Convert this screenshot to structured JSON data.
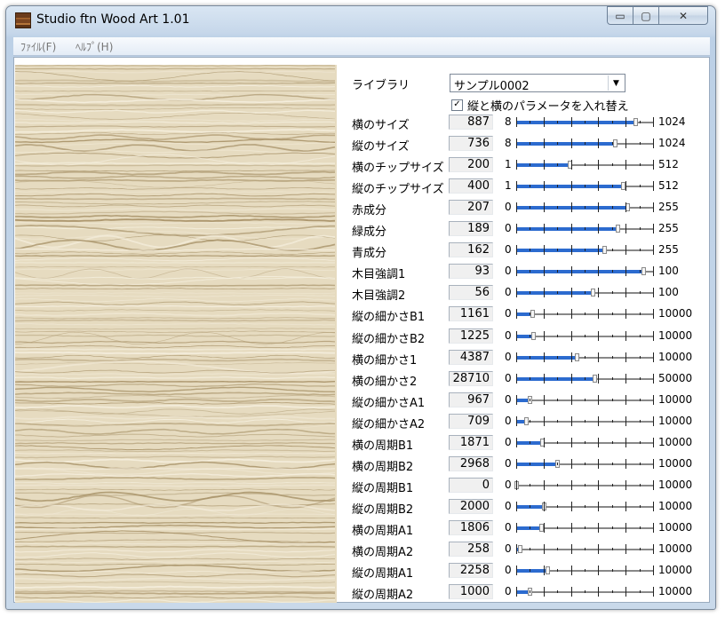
{
  "window": {
    "title": "Studio ftn Wood Art 1.01"
  },
  "titlebar_buttons": {
    "minimize": "▭",
    "maximize": "▢",
    "close": "✕"
  },
  "menu": [
    {
      "label": "ﾌｧｲﾙ(F)"
    },
    {
      "label": "ﾍﾙﾌﾟ(H)"
    }
  ],
  "library": {
    "label": "ライブラリ",
    "selected": "サンプル0002",
    "dropdown_icon": "chevron-down-icon"
  },
  "swap_checkbox": {
    "checked": true,
    "label": "縦と横のパラメータを入れ替え"
  },
  "wood_colors": {
    "base": "#e6dbc0",
    "dark": "#a58f64",
    "light": "#f6f0e0"
  },
  "sliders": [
    {
      "label": "横のサイズ",
      "value": "887",
      "min": "8",
      "max": "1024",
      "fraction": 0.87
    },
    {
      "label": "縦のサイズ",
      "value": "736",
      "min": "8",
      "max": "1024",
      "fraction": 0.72
    },
    {
      "label": "横のチップサイズ",
      "value": "200",
      "min": "1",
      "max": "512",
      "fraction": 0.39
    },
    {
      "label": "縦のチップサイズ",
      "value": "400",
      "min": "1",
      "max": "512",
      "fraction": 0.78
    },
    {
      "label": "赤成分",
      "value": "207",
      "min": "0",
      "max": "255",
      "fraction": 0.81
    },
    {
      "label": "緑成分",
      "value": "189",
      "min": "0",
      "max": "255",
      "fraction": 0.74
    },
    {
      "label": "青成分",
      "value": "162",
      "min": "0",
      "max": "255",
      "fraction": 0.64
    },
    {
      "label": "木目強調1",
      "value": "93",
      "min": "0",
      "max": "100",
      "fraction": 0.93
    },
    {
      "label": "木目強調2",
      "value": "56",
      "min": "0",
      "max": "100",
      "fraction": 0.56
    },
    {
      "label": "縦の細かさB1",
      "value": "1161",
      "min": "0",
      "max": "10000",
      "fraction": 0.116
    },
    {
      "label": "縦の細かさB2",
      "value": "1225",
      "min": "0",
      "max": "10000",
      "fraction": 0.123
    },
    {
      "label": "横の細かさ1",
      "value": "4387",
      "min": "0",
      "max": "10000",
      "fraction": 0.439
    },
    {
      "label": "横の細かさ2",
      "value": "28710",
      "min": "0",
      "max": "50000",
      "fraction": 0.574
    },
    {
      "label": "縦の細かさA1",
      "value": "967",
      "min": "0",
      "max": "10000",
      "fraction": 0.097
    },
    {
      "label": "縦の細かさA2",
      "value": "709",
      "min": "0",
      "max": "10000",
      "fraction": 0.071
    },
    {
      "label": "横の周期B1",
      "value": "1871",
      "min": "0",
      "max": "10000",
      "fraction": 0.187
    },
    {
      "label": "横の周期B2",
      "value": "2968",
      "min": "0",
      "max": "10000",
      "fraction": 0.297
    },
    {
      "label": "縦の周期B1",
      "value": "0",
      "min": "0",
      "max": "10000",
      "fraction": 0.0
    },
    {
      "label": "縦の周期B2",
      "value": "2000",
      "min": "0",
      "max": "10000",
      "fraction": 0.2
    },
    {
      "label": "横の周期A1",
      "value": "1806",
      "min": "0",
      "max": "10000",
      "fraction": 0.181
    },
    {
      "label": "横の周期A2",
      "value": "258",
      "min": "0",
      "max": "10000",
      "fraction": 0.026
    },
    {
      "label": "縦の周期A1",
      "value": "2258",
      "min": "0",
      "max": "10000",
      "fraction": 0.226
    },
    {
      "label": "縦の周期A2",
      "value": "1000",
      "min": "0",
      "max": "10000",
      "fraction": 0.1
    }
  ]
}
